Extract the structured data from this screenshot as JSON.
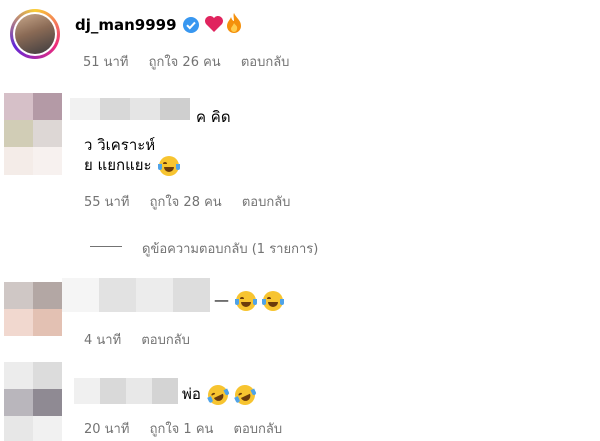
{
  "top_comment": {
    "username": "dj_man9999",
    "emojis": [
      "red-heart",
      "fire"
    ],
    "time": "51 นาที",
    "likes": "ถูกใจ 26 คน",
    "reply": "ตอบกลับ"
  },
  "comment2": {
    "line1_suffix": "ค คิด",
    "line2": "ว วิเคราะห์",
    "line3": "ย แยกแยะ",
    "emoji": "face-with-tears-of-joy",
    "time": "55 นาที",
    "likes": "ถูกใจ 28 คน",
    "reply": "ตอบกลับ",
    "view_replies": "ดูข้อความตอบกลับ (1 รายการ)"
  },
  "comment3": {
    "emojis": [
      "face-with-tears-of-joy",
      "face-with-tears-of-joy"
    ],
    "time": "4 นาที",
    "reply": "ตอบกลับ"
  },
  "comment4": {
    "text": "พ่อ",
    "emojis": [
      "rolling-on-floor-laughing",
      "rolling-on-floor-laughing"
    ],
    "time": "20 นาที",
    "likes": "ถูกใจ 1 คน",
    "reply": "ตอบกลับ"
  }
}
